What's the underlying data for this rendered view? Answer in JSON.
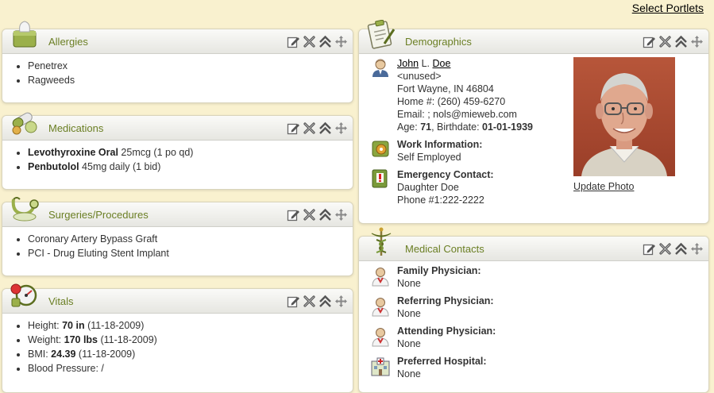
{
  "select_portlets": "Select Portlets",
  "allergies": {
    "title": "Allergies",
    "items": [
      "Penetrex",
      "Ragweeds"
    ]
  },
  "medications": {
    "title": "Medications",
    "items": [
      {
        "name": "Levothyroxine Oral",
        "detail": " 25mcg (1 po qd)"
      },
      {
        "name": "Penbutolol",
        "detail": " 45mg daily (1 bid)"
      }
    ]
  },
  "surgeries": {
    "title": "Surgeries/Procedures",
    "items": [
      "Coronary Artery Bypass Graft",
      "PCI - Drug Eluting Stent Implant"
    ]
  },
  "vitals": {
    "title": "Vitals",
    "items": [
      {
        "label": "Height: ",
        "value": "70 in",
        "date": " (11-18-2009)"
      },
      {
        "label": "Weight: ",
        "value": "170 lbs",
        "date": " (11-18-2009)"
      },
      {
        "label": "BMI: ",
        "value": "24.39",
        "date": " (11-18-2009)"
      },
      {
        "label": "Blood Pressure: /",
        "value": "",
        "date": ""
      }
    ]
  },
  "demographics": {
    "title": "Demographics",
    "first_name": "John",
    "middle_initial": "L.",
    "last_name": "Doe",
    "address1": "<unused>",
    "address2": "Fort Wayne, IN 46804",
    "home_phone": "Home #: (260) 459-6270",
    "email": "Email: ;     nols@mieweb.com",
    "age_label": "Age: ",
    "age": "71",
    "birthdate_label": ", Birthdate: ",
    "birthdate": "01-01-1939",
    "work_label": "Work Information:",
    "work_value": "Self Employed",
    "emergency_label": "Emergency Contact:",
    "emergency_name": "Daughter Doe",
    "emergency_phone": "Phone #1:222-2222",
    "update_photo": "Update Photo"
  },
  "medical_contacts": {
    "title": "Medical Contacts",
    "items": [
      {
        "label": "Family Physician:",
        "value": "None"
      },
      {
        "label": "Referring Physician:",
        "value": "None"
      },
      {
        "label": "Attending Physician:",
        "value": "None"
      },
      {
        "label": "Preferred Hospital:",
        "value": "None"
      }
    ]
  },
  "colors": {
    "background": "#f9f1cf",
    "title_green": "#6b7f24"
  }
}
